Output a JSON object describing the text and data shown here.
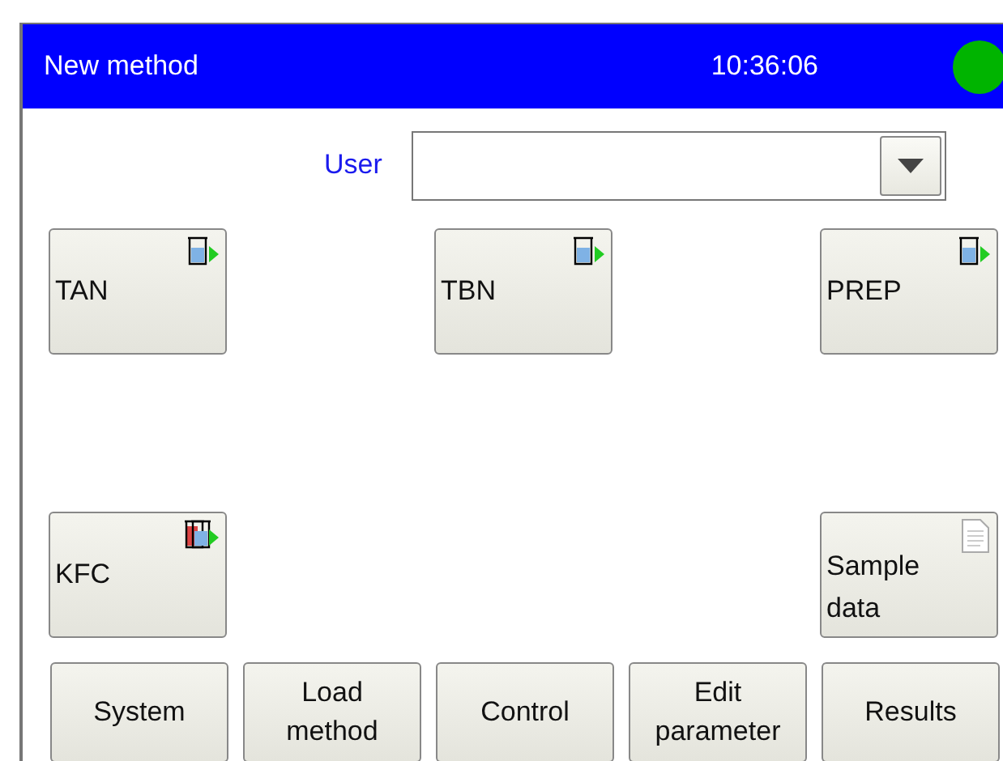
{
  "window": {
    "title": "New method",
    "time": "10:36:06"
  },
  "user": {
    "label": "User"
  },
  "tiles": [
    {
      "label": "TAN",
      "kind": "method"
    },
    {
      "label": "TBN",
      "kind": "method"
    },
    {
      "label": "PREP",
      "kind": "method"
    },
    {
      "label": "KFC",
      "kind": "kfc"
    },
    {
      "label": "Sample data",
      "kind": "sample"
    }
  ],
  "buttons": [
    "System",
    "Load method",
    "Control",
    "Edit parameter",
    "Results"
  ]
}
